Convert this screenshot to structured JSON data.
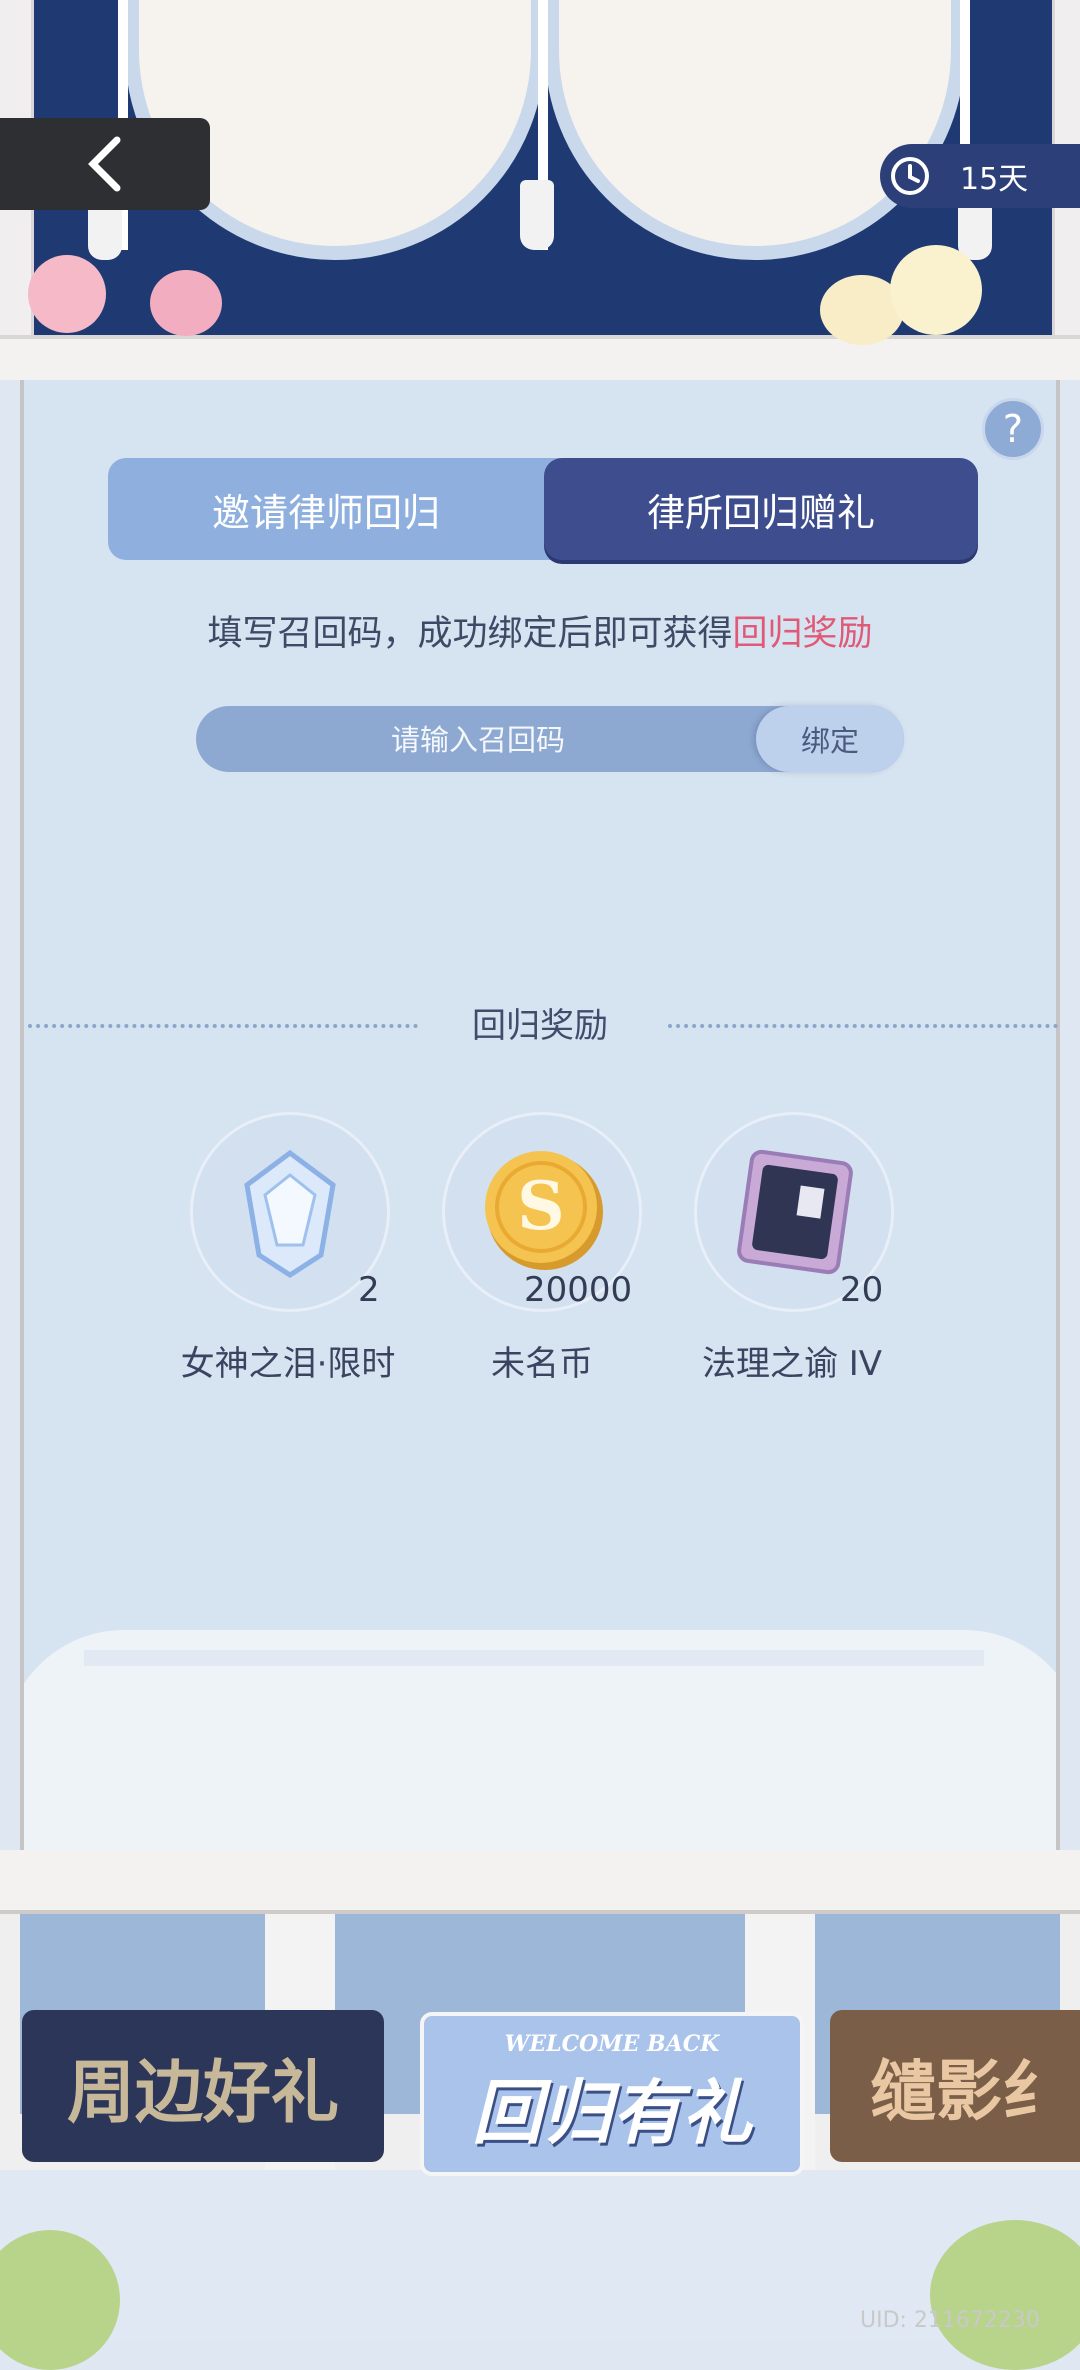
{
  "header": {
    "timer_label": "15天"
  },
  "tabs": [
    {
      "label": "邀请律师回归",
      "active": false
    },
    {
      "label": "律所回归赠礼",
      "active": true
    }
  ],
  "instruction": {
    "text": "填写召回码，成功绑定后即可获得",
    "highlight": "回归奖励"
  },
  "code_input": {
    "placeholder": "请输入召回码",
    "value": "",
    "bind_label": "绑定"
  },
  "rewards": {
    "title": "回归奖励",
    "items": [
      {
        "name": "女神之泪·限时",
        "count": "2",
        "icon": "crystal-tear-icon"
      },
      {
        "name": "未名币",
        "count": "20000",
        "icon": "gold-coin-icon"
      },
      {
        "name": "法理之谕 IV",
        "count": "20",
        "icon": "law-card-icon"
      }
    ]
  },
  "banners": [
    {
      "label": "周边好礼"
    },
    {
      "label": "回归有礼",
      "subtitle": "WELCOME BACK"
    },
    {
      "label": "缱影纟"
    }
  ],
  "footer": {
    "uid": "UID: 211672230"
  },
  "colors": {
    "accent_highlight": "#e05a78",
    "tab_active": "#3e4d8e",
    "tab_inactive": "#8fb0df",
    "panel_bg": "#d6e3f0"
  }
}
